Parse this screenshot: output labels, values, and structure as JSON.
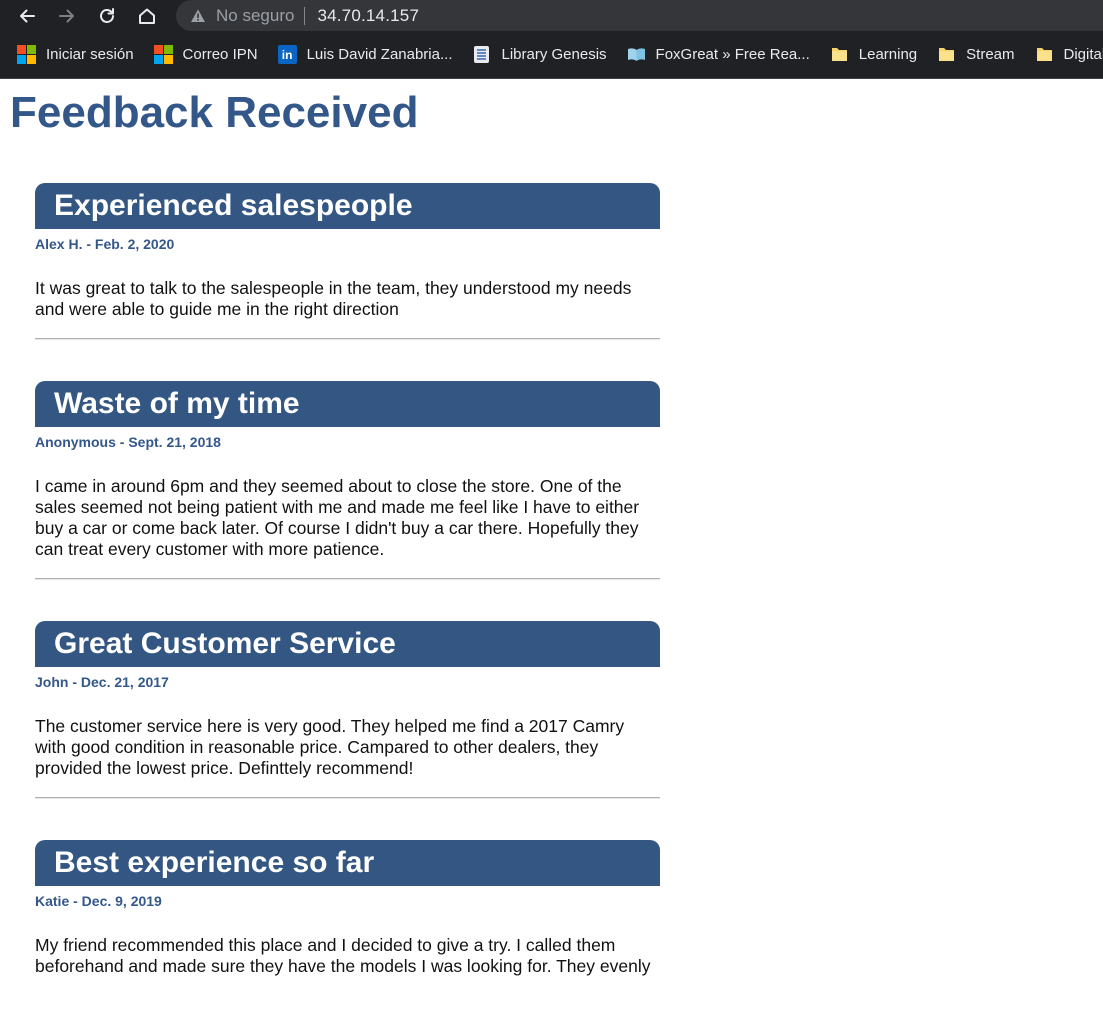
{
  "browser": {
    "nav": {
      "back_icon": "arrow-left-icon",
      "forward_icon": "arrow-right-icon",
      "reload_icon": "reload-icon",
      "home_icon": "home-icon"
    },
    "omnibox": {
      "security_label": "No seguro",
      "url": "34.70.14.157"
    },
    "bookmarks": [
      {
        "label": "Iniciar sesión",
        "icon": "microsoft-icon"
      },
      {
        "label": "Correo IPN",
        "icon": "microsoft-icon"
      },
      {
        "label": "Luis David Zanabria...",
        "icon": "linkedin-icon"
      },
      {
        "label": "Library Genesis",
        "icon": "library-icon"
      },
      {
        "label": "FoxGreat » Free Rea...",
        "icon": "book-icon"
      },
      {
        "label": "Learning",
        "icon": "folder-icon"
      },
      {
        "label": "Stream",
        "icon": "folder-icon"
      },
      {
        "label": "Digital M",
        "icon": "folder-icon"
      }
    ]
  },
  "page": {
    "title": "Feedback Received",
    "colors": {
      "accent": "#335782",
      "title": "#34578a"
    },
    "feedback": [
      {
        "title": "Experienced salespeople",
        "meta": "Alex H. - Feb. 2, 2020",
        "body": "It was great to talk to the salespeople in the team, they understood my needs and were able to guide me in the right direction"
      },
      {
        "title": "Waste of my time",
        "meta": "Anonymous - Sept. 21, 2018",
        "body": "I came in around 6pm and they seemed about to close the store. One of the sales seemed not being patient with me and made me feel like I have to either buy a car or come back later. Of course I didn't buy a car there. Hopefully they can treat every customer with more patience."
      },
      {
        "title": "Great Customer Service",
        "meta": "John - Dec. 21, 2017",
        "body": "The customer service here is very good. They helped me find a 2017 Camry with good condition in reasonable price. Campared to other dealers, they provided the lowest price. Definttely recommend!"
      },
      {
        "title": "Best experience so far",
        "meta": "Katie - Dec. 9, 2019",
        "body": "My friend recommended this place and I decided to give a try. I called them beforehand and made sure they have the models I was looking for. They evenly"
      }
    ]
  }
}
